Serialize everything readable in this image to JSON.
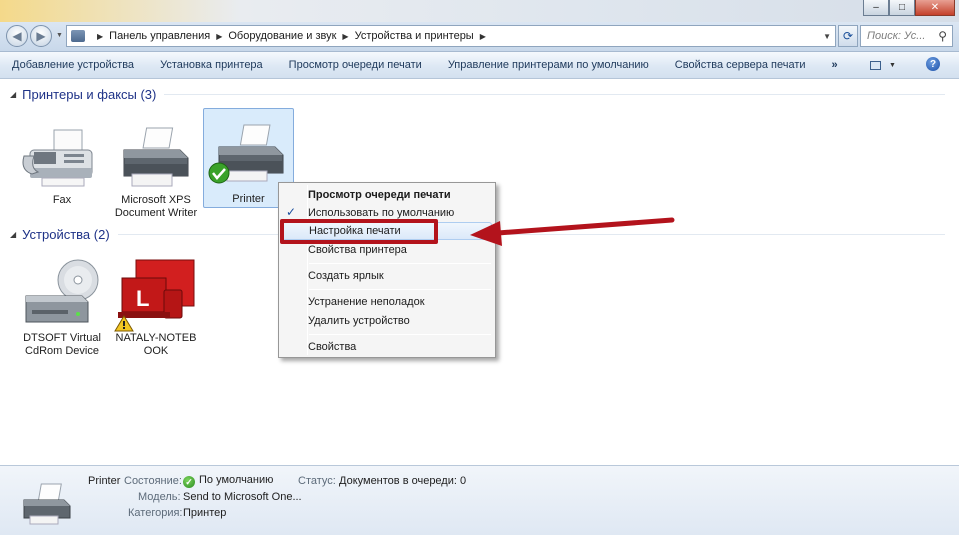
{
  "window": {
    "caption_buttons": [
      "minimize",
      "maximize",
      "close"
    ]
  },
  "address_bar": {
    "breadcrumbs": [
      "Панель управления",
      "Оборудование и звук",
      "Устройства и принтеры"
    ],
    "search_placeholder": "Поиск: Ус..."
  },
  "toolbar": {
    "items": [
      "Добавление устройства",
      "Установка принтера",
      "Просмотр очереди печати",
      "Управление принтерами по умолчанию",
      "Свойства сервера печати"
    ],
    "more": "»"
  },
  "groups": {
    "printers": {
      "title": "Принтеры и факсы (3)",
      "items": [
        {
          "label_lines": [
            "Fax"
          ],
          "icon": "fax-icon"
        },
        {
          "label_lines": [
            "Microsoft XPS",
            "Document Writer"
          ],
          "icon": "printer-icon"
        },
        {
          "label_lines": [
            "Printer"
          ],
          "icon": "printer-icon",
          "selected": true,
          "default_badge": "check-badge-icon"
        }
      ]
    },
    "devices": {
      "title": "Устройства (2)",
      "items": [
        {
          "label_lines": [
            "DTSOFT Virtual",
            "CdRom Device"
          ],
          "icon": "cdrom-drive-icon"
        },
        {
          "label_lines": [
            "NATALY-NOTEB",
            "OOK"
          ],
          "icon": "computer-icon",
          "badge": "warning-icon"
        }
      ]
    }
  },
  "context_menu": {
    "items": [
      {
        "label": "Просмотр очереди печати",
        "bold": true
      },
      {
        "label": "Использовать по умолчанию",
        "checked": true
      },
      {
        "label": "Настройка печати",
        "highlighted": true
      },
      {
        "label": "Свойства принтера"
      },
      {
        "label": "Создать ярлык"
      },
      {
        "label": "Устранение неполадок"
      },
      {
        "label": "Удалить устройство"
      },
      {
        "label": "Свойства"
      }
    ]
  },
  "annotation": {
    "color": "#b3131c"
  },
  "details": {
    "name": "Printer",
    "state_label": "Состояние:",
    "state_value": "По умолчанию",
    "status_label": "Статус:",
    "status_value": "Документов в очереди: 0",
    "model_label": "Модель:",
    "model_value": "Send to Microsoft One...",
    "category_label": "Категория:",
    "category_value": "Принтер"
  }
}
